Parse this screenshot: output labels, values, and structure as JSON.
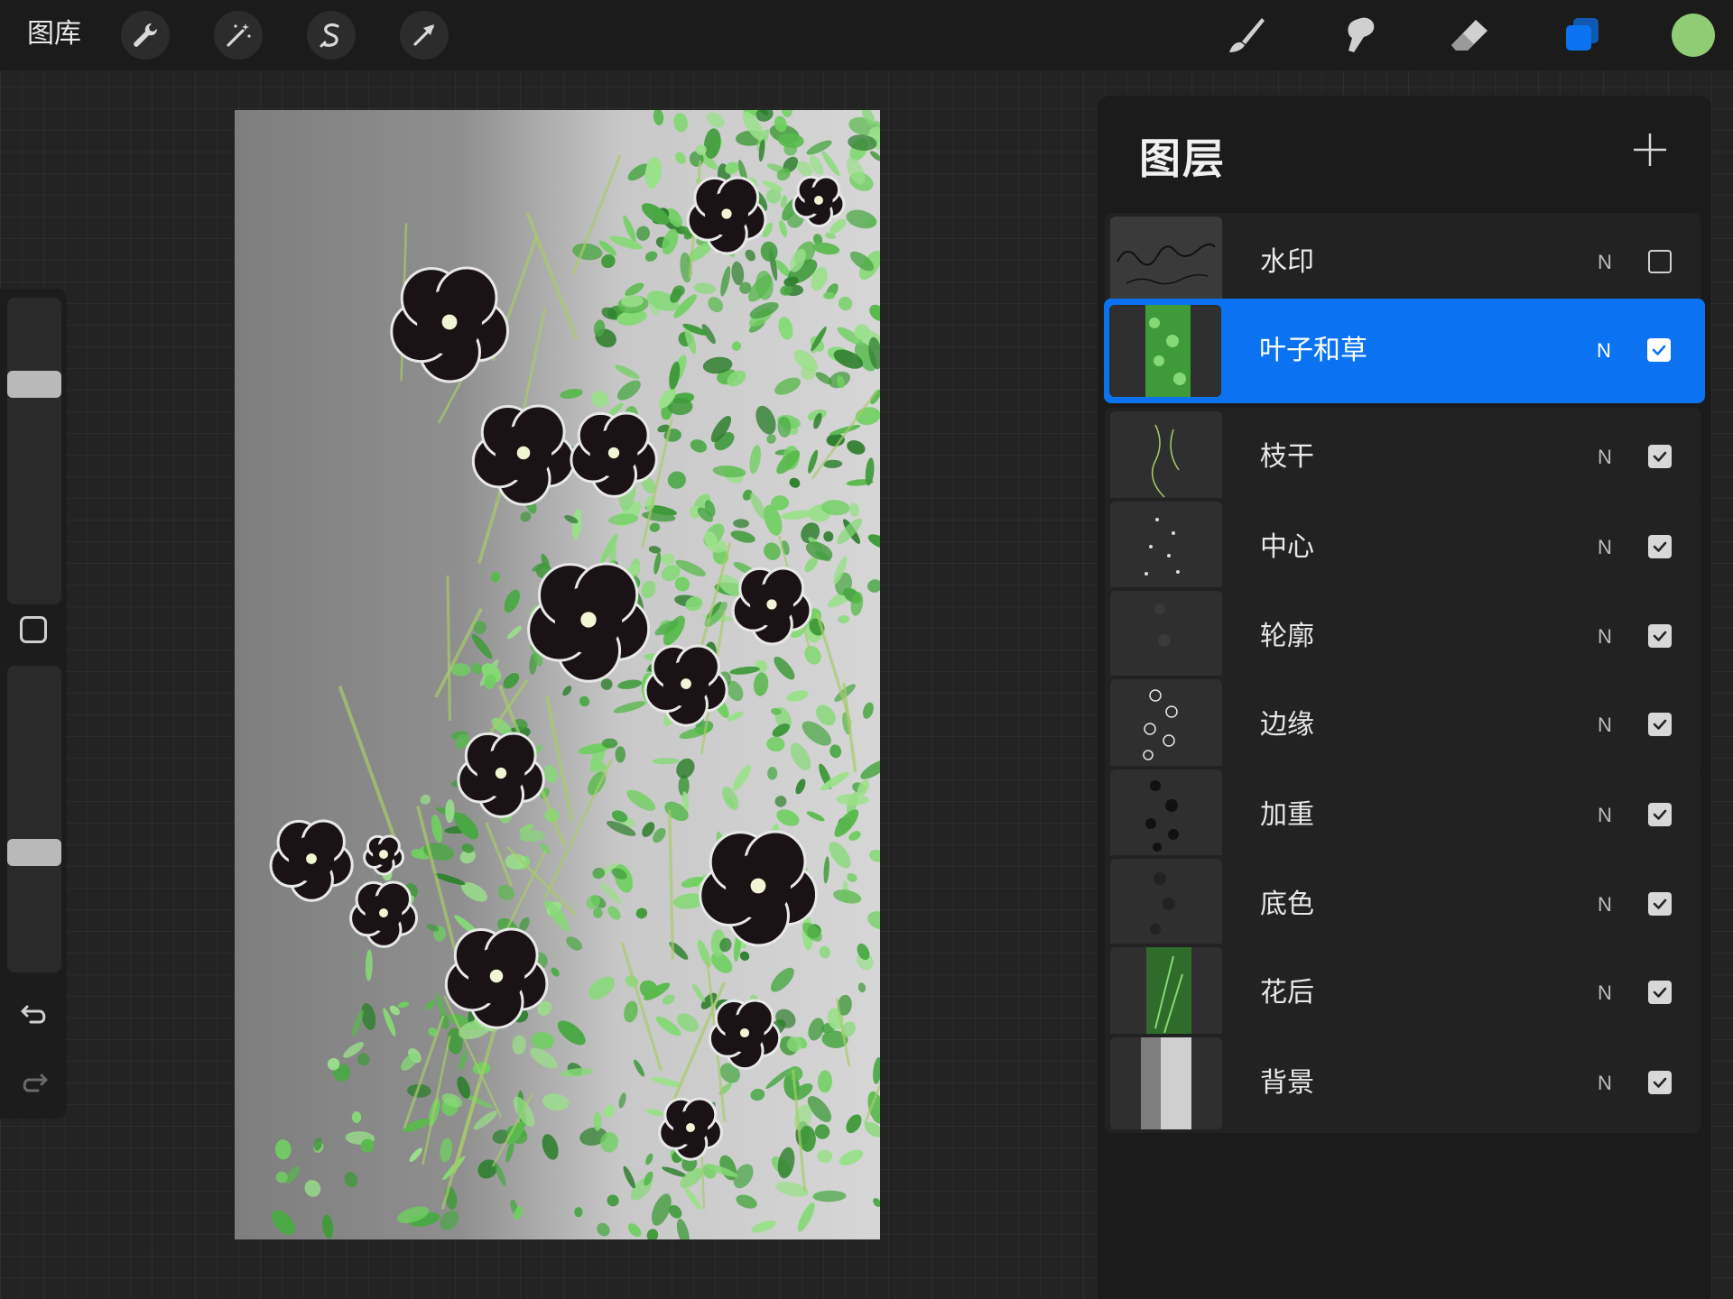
{
  "toolbar": {
    "gallery_label": "图库",
    "left_tools": [
      "wrench-icon",
      "magic-wand-icon",
      "selection-s-icon",
      "transform-arrow-icon"
    ],
    "right_tools": [
      "brush-icon",
      "smudge-icon",
      "eraser-icon",
      "layers-icon"
    ],
    "active_tool": "layers-icon",
    "current_color": "#8fcc74",
    "accent_color": "#0b73f2"
  },
  "sidebar": {
    "brush_size_fraction": 0.26,
    "opacity_fraction": 0.62,
    "undo_icon": "undo-arrow-icon",
    "redo_icon": "redo-arrow-icon"
  },
  "layers_panel": {
    "title": "图层",
    "add_icon": "plus-icon",
    "layers": [
      {
        "name": "水印",
        "blend": "N",
        "visible": false,
        "selected": false
      },
      {
        "name": "叶子和草",
        "blend": "N",
        "visible": true,
        "selected": true
      },
      {
        "name": "枝干",
        "blend": "N",
        "visible": true,
        "selected": false
      },
      {
        "name": "中心",
        "blend": "N",
        "visible": true,
        "selected": false
      },
      {
        "name": "轮廓",
        "blend": "N",
        "visible": true,
        "selected": false
      },
      {
        "name": "边缘",
        "blend": "N",
        "visible": true,
        "selected": false
      },
      {
        "name": "加重",
        "blend": "N",
        "visible": true,
        "selected": false
      },
      {
        "name": "底色",
        "blend": "N",
        "visible": true,
        "selected": false
      },
      {
        "name": "花后",
        "blend": "N",
        "visible": true,
        "selected": false
      },
      {
        "name": "背景",
        "blend": "N",
        "visible": true,
        "selected": false
      }
    ]
  }
}
